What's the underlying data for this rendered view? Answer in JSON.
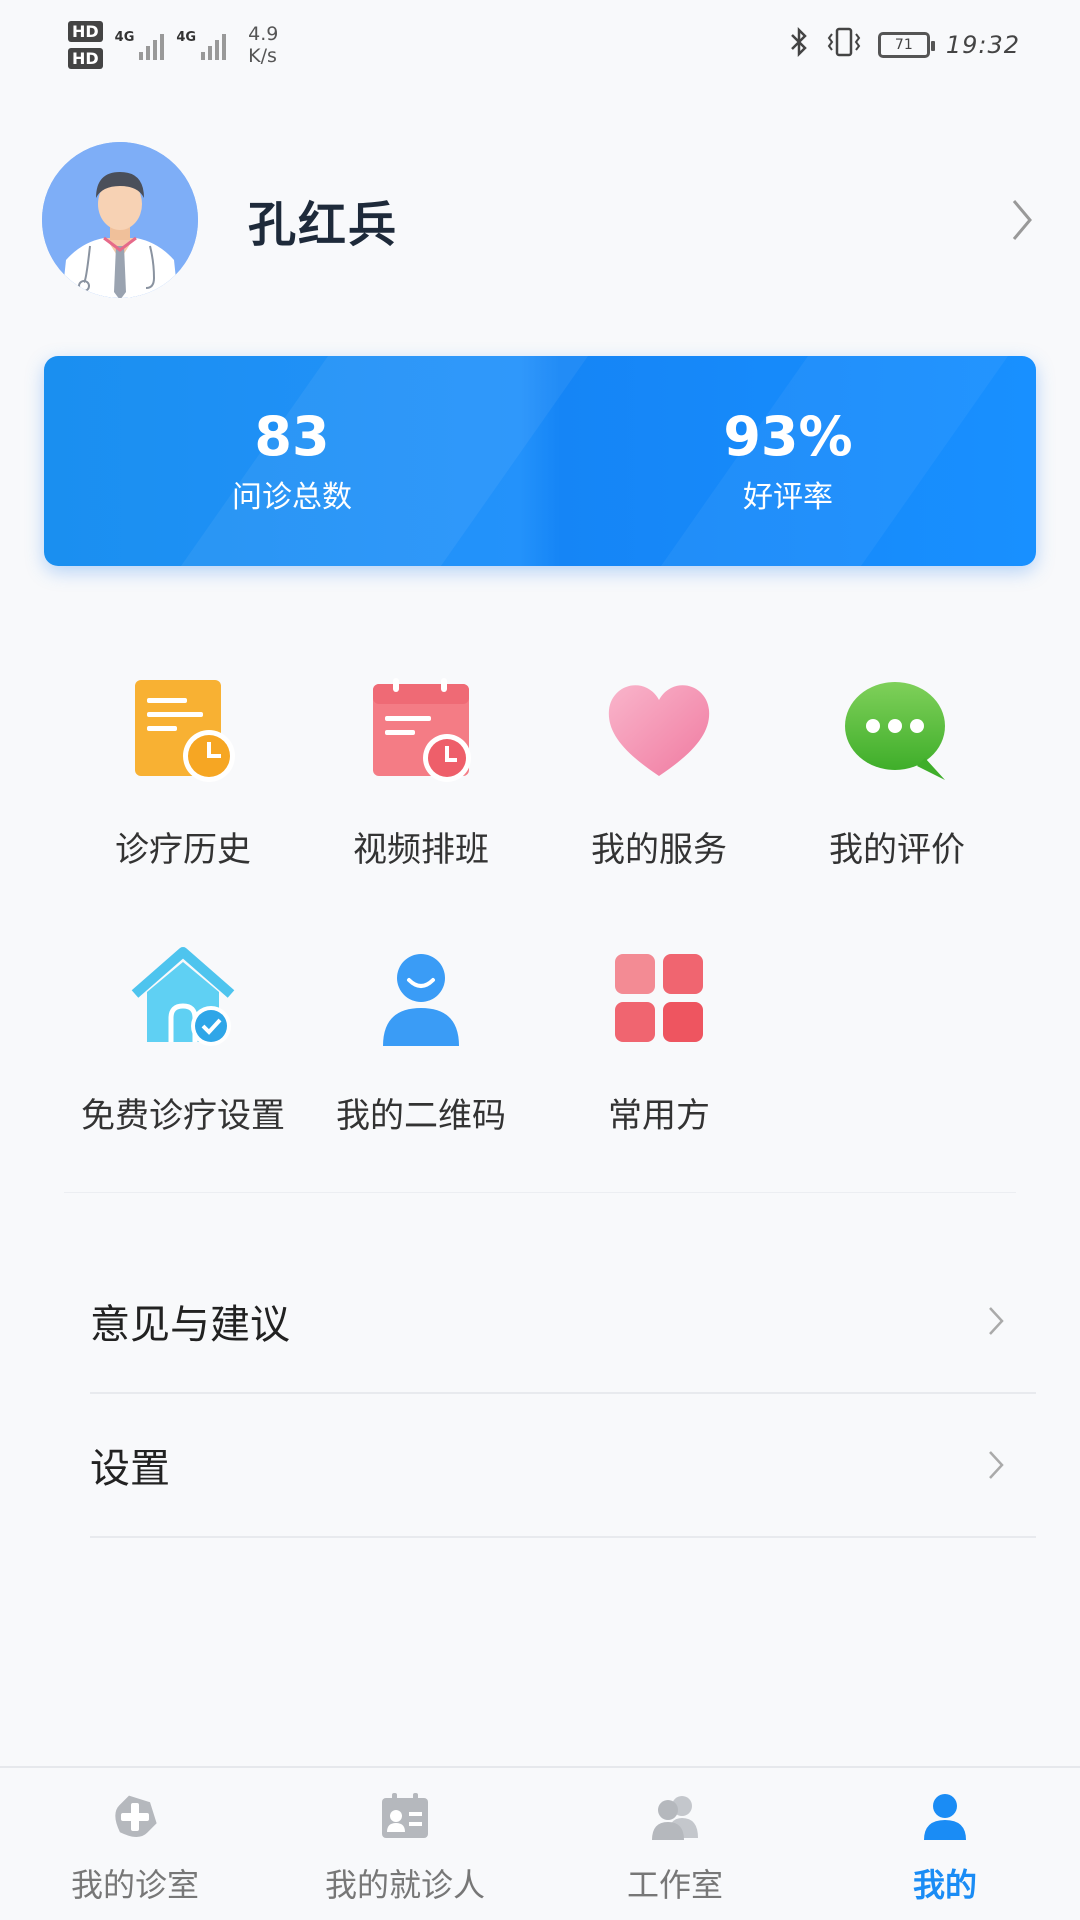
{
  "status_bar": {
    "hd1": "HD",
    "hd2": "HD",
    "net1": "4G",
    "net2": "4G",
    "speed_value": "4.9",
    "speed_unit": "K/s",
    "battery": "71",
    "time": "19:32"
  },
  "profile": {
    "name": "孔红兵"
  },
  "stats": [
    {
      "value": "83",
      "label": "问诊总数"
    },
    {
      "value": "93%",
      "label": "好评率"
    }
  ],
  "grid": {
    "row1": [
      {
        "label": "诊疗历史",
        "icon": "clipboard-clock-icon"
      },
      {
        "label": "视频排班",
        "icon": "calendar-clock-icon"
      },
      {
        "label": "我的服务",
        "icon": "heart-icon"
      },
      {
        "label": "我的评价",
        "icon": "chat-bubble-icon"
      }
    ],
    "row2": [
      {
        "label": "免费诊疗设置",
        "icon": "house-check-icon"
      },
      {
        "label": "我的二维码",
        "icon": "person-icon"
      },
      {
        "label": "常用方",
        "icon": "grid-squares-icon"
      }
    ]
  },
  "menu": [
    {
      "label": "意见与建议"
    },
    {
      "label": "设置"
    }
  ],
  "bottom_nav": [
    {
      "label": "我的诊室",
      "icon": "plus-shield-icon",
      "active": false
    },
    {
      "label": "我的就诊人",
      "icon": "contact-card-icon",
      "active": false
    },
    {
      "label": "工作室",
      "icon": "group-icon",
      "active": false
    },
    {
      "label": "我的",
      "icon": "user-icon",
      "active": true
    }
  ],
  "colors": {
    "primary": "#1890ff",
    "nav_active": "#1a8cf5",
    "nav_inactive": "#aaaaaa"
  }
}
